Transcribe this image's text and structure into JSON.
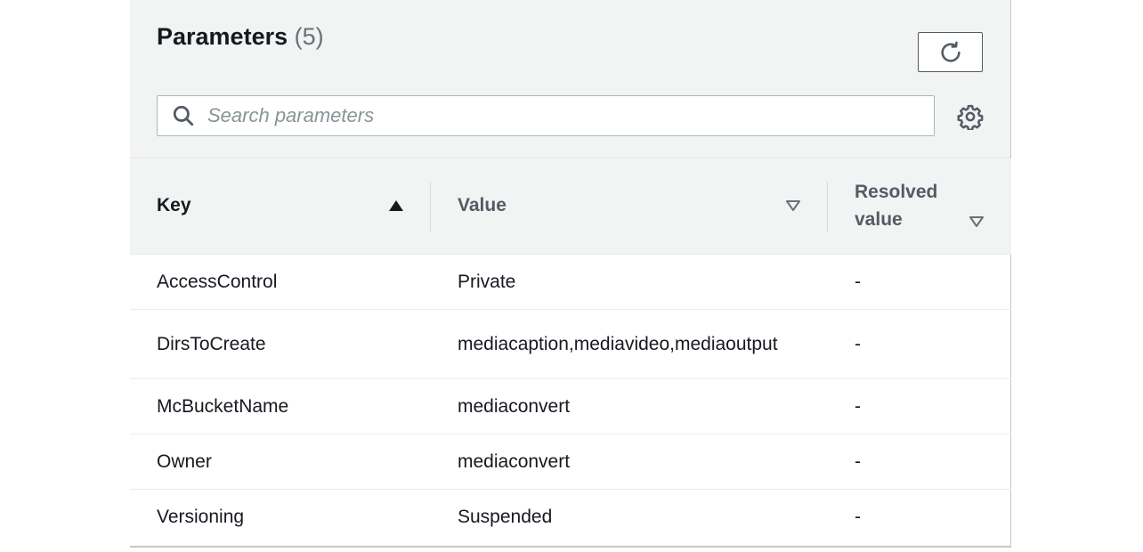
{
  "panel": {
    "title": "Parameters",
    "count": "(5)",
    "refresh_icon": "refresh-icon",
    "settings_icon": "gear-icon"
  },
  "search": {
    "placeholder": "Search parameters",
    "value": "",
    "icon": "search-icon"
  },
  "table": {
    "columns": [
      {
        "label": "Key",
        "sort": "ascending"
      },
      {
        "label": "Value",
        "sort": "none"
      },
      {
        "label_line1": "Resolved",
        "label_line2": "value",
        "sort": "none"
      }
    ],
    "rows": [
      {
        "key": "AccessControl",
        "value": "Private",
        "resolved": "-"
      },
      {
        "key": "DirsToCreate",
        "value": "mediacaption,mediavideo,mediaoutput",
        "resolved": "-"
      },
      {
        "key": "McBucketName",
        "value": "mediaconvert",
        "resolved": "-"
      },
      {
        "key": "Owner",
        "value": "mediaconvert",
        "resolved": "-"
      },
      {
        "key": "Versioning",
        "value": "Suspended",
        "resolved": "-"
      }
    ]
  }
}
